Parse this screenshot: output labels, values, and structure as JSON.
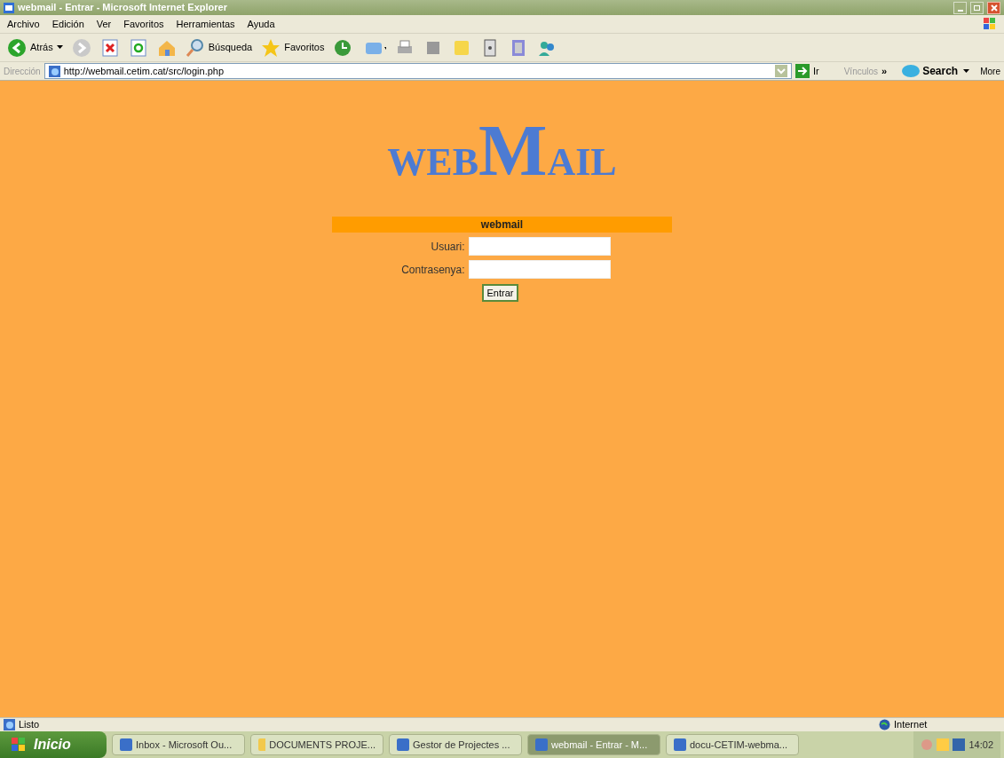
{
  "window": {
    "title": "webmail - Entrar - Microsoft Internet Explorer"
  },
  "menu": [
    "Archivo",
    "Edición",
    "Ver",
    "Favoritos",
    "Herramientas",
    "Ayuda"
  ],
  "toolbar": {
    "back": "Atrás",
    "search": "Búsqueda",
    "favorites": "Favoritos"
  },
  "address_bar": {
    "label": "Dirección",
    "url": "http://webmail.cetim.cat/src/login.php",
    "go": "Ir",
    "links": "Vínculos",
    "chevron": "»",
    "search": "Search",
    "more": "More"
  },
  "logo": {
    "left": "WEB",
    "big": "M",
    "right": "AIL"
  },
  "login": {
    "heading": "webmail",
    "fields": [
      {
        "label": "Usuari:"
      },
      {
        "label": "Contrasenya:"
      }
    ],
    "button": "Entrar"
  },
  "status_bar": {
    "text": "Listo",
    "zone": "Internet"
  },
  "taskbar": {
    "start": "Inicio",
    "clock": "14:02",
    "items": [
      {
        "label": "Inbox - Microsoft Ou...",
        "selected": false
      },
      {
        "label": "DOCUMENTS PROJE...",
        "selected": false
      },
      {
        "label": "Gestor de Projectes ...",
        "selected": false
      },
      {
        "label": "webmail - Entrar - M...",
        "selected": true
      },
      {
        "label": "docu-CETIM-webma...",
        "selected": false
      }
    ]
  }
}
